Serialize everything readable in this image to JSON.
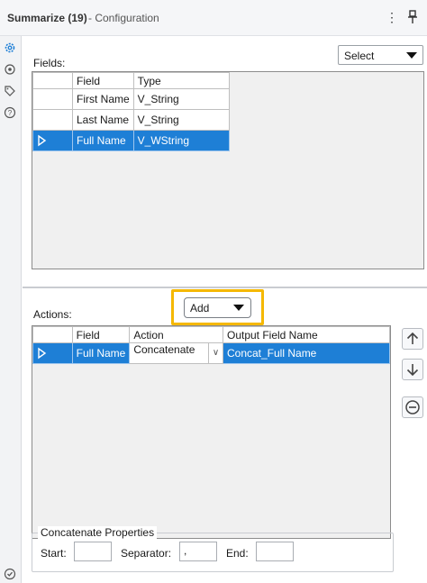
{
  "window": {
    "title": "Summarize (19)",
    "subtitle": "- Configuration",
    "kebab_glyph": "⋮"
  },
  "rail": {
    "icons": [
      "gear-icon",
      "target-icon",
      "tag-icon",
      "help-icon",
      "check-icon"
    ]
  },
  "fields_section": {
    "label": "Fields:",
    "select_label": "Select",
    "columns": [
      "Field",
      "Type"
    ],
    "rows": [
      {
        "field": "First Name",
        "type": "V_String"
      },
      {
        "field": "Last Name",
        "type": "V_String"
      },
      {
        "field": "Full Name",
        "type": "V_WString",
        "selected": true
      }
    ]
  },
  "actions_section": {
    "label": "Actions:",
    "add_label": "Add",
    "columns": [
      "Field",
      "Action",
      "Output Field Name"
    ],
    "rows": [
      {
        "field": "Full Name",
        "action": "Concatenate",
        "output": "Concat_Full Name",
        "selected": true
      }
    ],
    "side_buttons": [
      "move-up-button",
      "move-down-button",
      "remove-button"
    ]
  },
  "concatenate": {
    "legend": "Concatenate Properties",
    "start_label": "Start:",
    "start_value": "",
    "separator_label": "Separator:",
    "separator_value": ",",
    "end_label": "End:",
    "end_value": ""
  },
  "colors": {
    "selection": "#1e7fd6",
    "highlight": "#f5b800"
  }
}
